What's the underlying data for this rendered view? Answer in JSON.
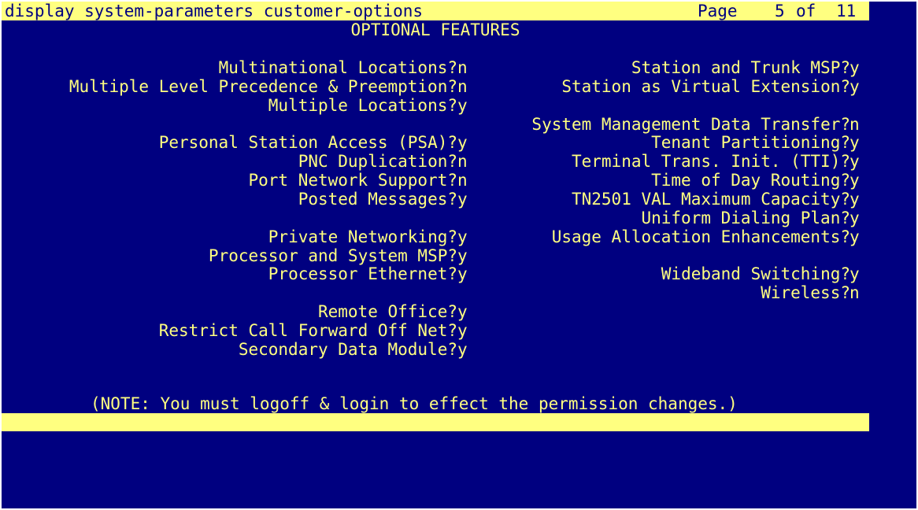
{
  "header": {
    "command": "display system-parameters customer-options",
    "page_label": "Page",
    "page_current": "5",
    "page_of": "of",
    "page_total": "11"
  },
  "title": "OPTIONAL FEATURES",
  "left_fields": [
    {
      "label": "Multinational Locations?",
      "value": "n"
    },
    {
      "label": "Multiple Level Precedence & Preemption?",
      "value": "n"
    },
    {
      "label": "Multiple Locations?",
      "value": "y"
    },
    {
      "label": "Personal Station Access (PSA)?",
      "value": "y"
    },
    {
      "label": "PNC Duplication?",
      "value": "n"
    },
    {
      "label": "Port Network Support?",
      "value": "n"
    },
    {
      "label": "Posted Messages?",
      "value": "y"
    },
    {
      "label": "Private Networking?",
      "value": "y"
    },
    {
      "label": "Processor and System MSP?",
      "value": "y"
    },
    {
      "label": "Processor Ethernet?",
      "value": "y"
    },
    {
      "label": "Remote Office?",
      "value": "y"
    },
    {
      "label": "Restrict Call Forward Off Net?",
      "value": "y"
    },
    {
      "label": "Secondary Data Module?",
      "value": "y"
    }
  ],
  "right_fields": [
    {
      "label": "Station and Trunk MSP?",
      "value": "y"
    },
    {
      "label": "Station as Virtual Extension?",
      "value": "y"
    },
    {
      "label": "System Management Data Transfer?",
      "value": "n"
    },
    {
      "label": "Tenant Partitioning?",
      "value": "y"
    },
    {
      "label": "Terminal Trans. Init. (TTI)?",
      "value": "y"
    },
    {
      "label": "Time of Day Routing?",
      "value": "y"
    },
    {
      "label": "TN2501 VAL Maximum Capacity?",
      "value": "y"
    },
    {
      "label": "Uniform Dialing Plan?",
      "value": "y"
    },
    {
      "label": "Usage Allocation Enhancements?",
      "value": "y"
    },
    {
      "label": "Wideband Switching?",
      "value": "y"
    },
    {
      "label": "Wireless?",
      "value": "n"
    }
  ],
  "note": "(NOTE: You must logoff & login to effect the permission changes.)",
  "colors": {
    "background": "#000080",
    "text": "#ffff80",
    "bar": "#ffff80"
  }
}
